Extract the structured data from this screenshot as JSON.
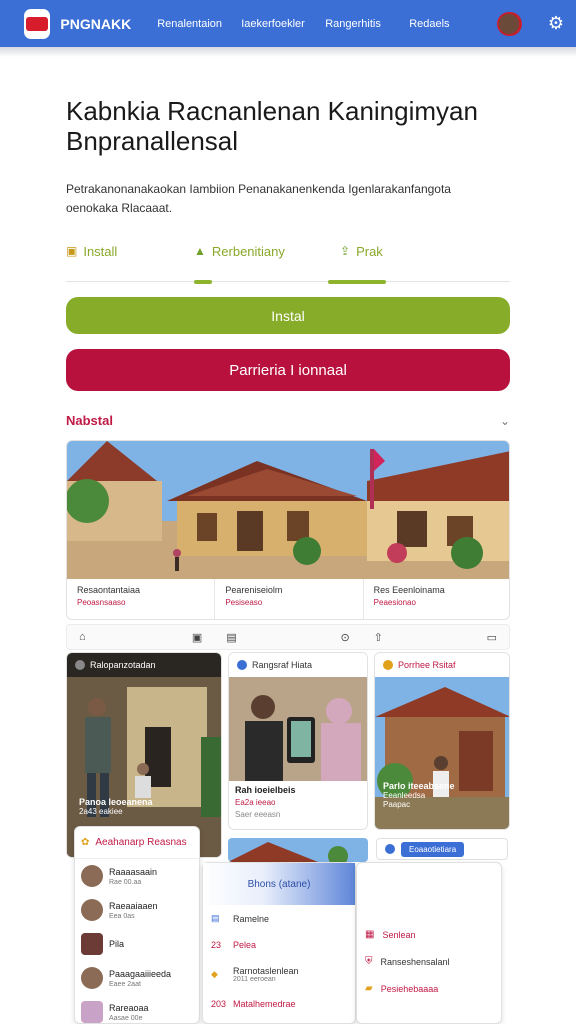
{
  "topnav": {
    "brand": "PNGNAKK",
    "links": [
      "Renalentaion",
      "Iaekerfoekler",
      "Rangerhitis",
      "Redaels"
    ],
    "colors": {
      "bar": "#3b6fd6"
    }
  },
  "header": {
    "title": "Kabnkia Racnanlenan Kaningimyan Bnpranallensal",
    "description": "Petrakanonanakaokan Iambiion Penanakanenkenda Igenlarakanfangota oenokaka Rlacaaat."
  },
  "tabs": [
    {
      "label": "Install",
      "icon": "download-icon"
    },
    {
      "label": "Rerbenitiany",
      "icon": "play-icon"
    },
    {
      "label": "Prak",
      "icon": "share-icon"
    }
  ],
  "buttons": {
    "install": "Instal",
    "secondary": "Parrieria I ionnaal"
  },
  "section": {
    "title": "Nabstal",
    "chevron": "⌄"
  },
  "hero": {
    "captions": [
      {
        "title": "Resaontantaiaa",
        "sub": "Peoasnsaaso"
      },
      {
        "title": "Peareniseiolm",
        "sub": "Pesiseaso"
      },
      {
        "title": "Res Eeenloinama",
        "sub": "Peaesionao"
      }
    ]
  },
  "toolbar": {
    "icons": [
      "home-icon",
      "image-icon",
      "document-icon",
      "search-icon",
      "upload-icon",
      "folder-icon"
    ]
  },
  "cards": [
    {
      "head": "Ralopanzotadan",
      "title": "Panoa leoeanena",
      "sub": "2a43 eakiee"
    },
    {
      "head": "Rangsraf Hiata",
      "title": "Rah ioeielbeis",
      "sub": "Ea2a ieeao",
      "sub2": "Saer eeeasn"
    },
    {
      "head": "Porrhee Rsitaf",
      "title": "Parlo iteeabsene",
      "sub": "Eeanleedsa",
      "sub2": "Paapac"
    }
  ],
  "strip": {
    "button": "Eoaaotietiara"
  },
  "panel_left": {
    "title": "Aeahanarp Reasnas",
    "items": [
      {
        "a": "Raaaasaain",
        "b": "Rae 00.aa"
      },
      {
        "a": "Raeaaiaaen",
        "b": "Eea 0as"
      },
      {
        "a": "Pila",
        "b": ""
      },
      {
        "a": "Paaagaaiiieeda",
        "b": "Eaee 2aat"
      },
      {
        "a": "Rareaoaa",
        "b": "Aasae 00e"
      }
    ]
  },
  "panel_mid": {
    "title": "Bhons (atane)",
    "items": [
      {
        "num": "",
        "a": "Ramelne",
        "b": ""
      },
      {
        "num": "23",
        "a": "Pelea",
        "b": ""
      },
      {
        "num": "",
        "a": "Rarnotaslenlean",
        "b": "2011 eeroean"
      },
      {
        "num": "203",
        "a": "Matalhemedrae",
        "b": ""
      }
    ]
  },
  "panel_right": {
    "items": [
      {
        "a": "",
        "plain": true
      },
      {
        "a": "Senlean",
        "plain": false
      },
      {
        "a": "Ranseshensalanl",
        "plain": true
      },
      {
        "a": "Pesiehebaaaa",
        "plain": false
      }
    ]
  }
}
